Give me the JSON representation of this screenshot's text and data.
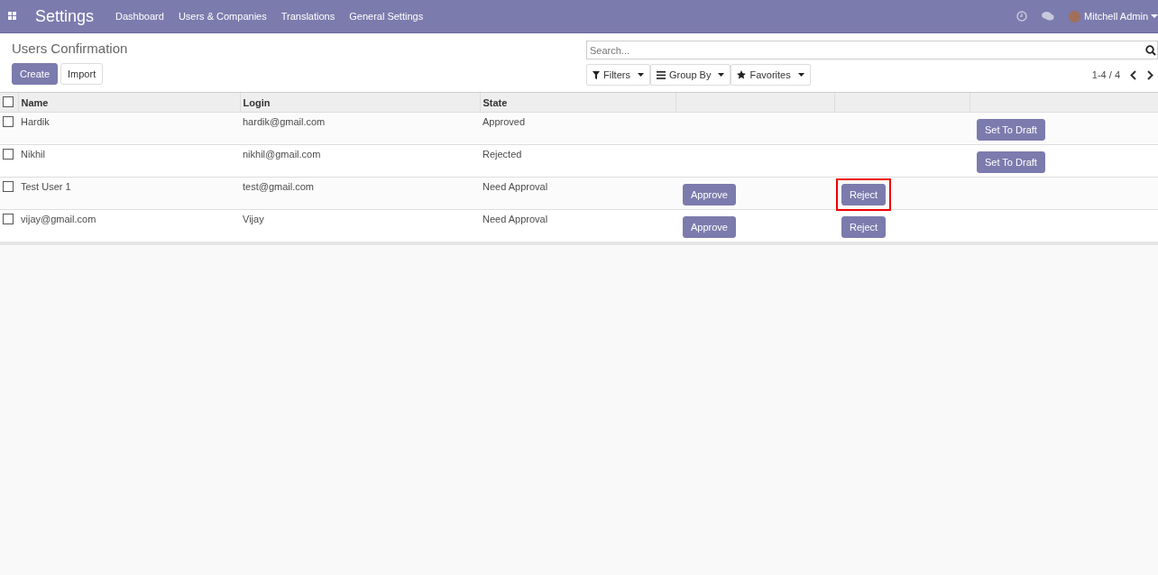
{
  "navbar": {
    "app_title": "Settings",
    "menu": [
      "Dashboard",
      "Users & Companies",
      "Translations",
      "General Settings"
    ],
    "user": "Mitchell Admin"
  },
  "control_panel": {
    "breadcrumb": "Users Confirmation",
    "buttons": [
      "Create",
      "Import"
    ],
    "search": {
      "placeholder": "Search..."
    },
    "filters": [
      "Filters",
      "Group By",
      "Favorites"
    ],
    "pager": "1-4 / 4"
  },
  "table": {
    "select_all": {
      "checked": false
    },
    "columns": [
      "Name",
      "Login",
      "State"
    ],
    "rows": [
      {
        "checked": false,
        "name": "Hardik",
        "login": "hardik@gmail.com",
        "state": "Approved",
        "actions": [
          {
            "kind": "draft",
            "label": "Set To Draft",
            "highlighted": false
          }
        ]
      },
      {
        "checked": false,
        "name": "Nikhil",
        "login": "nikhil@gmail.com",
        "state": "Rejected",
        "actions": [
          {
            "kind": "draft",
            "label": "Set To Draft",
            "highlighted": false
          }
        ]
      },
      {
        "checked": false,
        "name": "Test User 1",
        "login": "test@gmail.com",
        "state": "Need Approval",
        "actions": [
          {
            "kind": "approve",
            "label": "Approve",
            "highlighted": false
          },
          {
            "kind": "reject",
            "label": "Reject",
            "highlighted": true
          }
        ]
      },
      {
        "checked": false,
        "name": "vijay@gmail.com",
        "login": "Vijay",
        "state": "Need Approval",
        "actions": [
          {
            "kind": "approve",
            "label": "Approve",
            "highlighted": false
          },
          {
            "kind": "reject",
            "label": "Reject",
            "highlighted": false
          }
        ]
      }
    ]
  }
}
